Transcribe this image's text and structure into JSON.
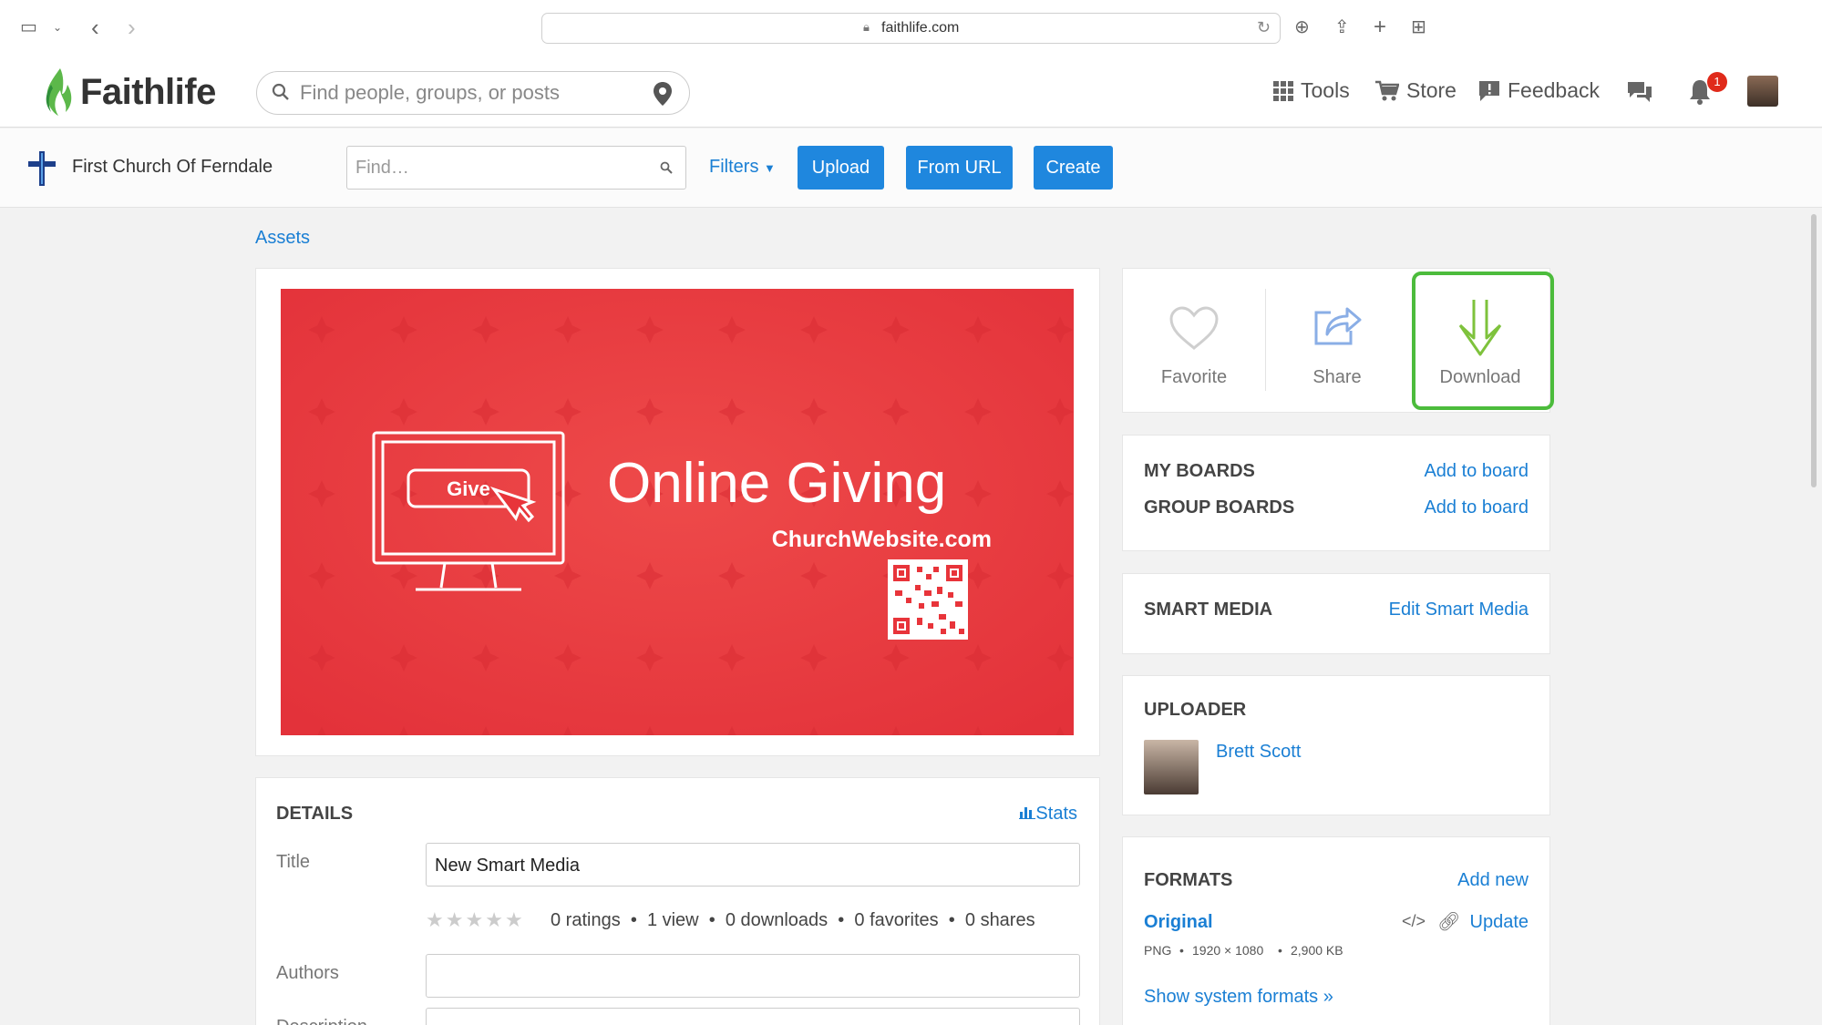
{
  "browser": {
    "url": "faithlife.com"
  },
  "header": {
    "logo_text": "Faithlife",
    "search_placeholder": "Find people, groups, or posts",
    "nav": {
      "tools": "Tools",
      "store": "Store",
      "feedback": "Feedback"
    },
    "notification_count": "1"
  },
  "group_bar": {
    "group_name": "First Church Of Ferndale",
    "find_placeholder": "Find…",
    "filters_label": "Filters",
    "upload_label": "Upload",
    "from_url_label": "From URL",
    "create_label": "Create"
  },
  "breadcrumb": "Assets",
  "preview": {
    "give_label": "Give",
    "headline": "Online Giving",
    "website": "ChurchWebsite.com",
    "colors": {
      "background": "#e8343a",
      "foreground": "#ffffff"
    }
  },
  "actions": {
    "favorite": "Favorite",
    "share": "Share",
    "download": "Download",
    "highlight_color": "#4cbc3c"
  },
  "boards": {
    "my_boards": "MY BOARDS",
    "group_boards": "GROUP BOARDS",
    "add_to_board": "Add to board"
  },
  "smart_media": {
    "heading": "SMART MEDIA",
    "edit_link": "Edit Smart Media"
  },
  "uploader": {
    "heading": "UPLOADER",
    "name": "Brett Scott"
  },
  "formats": {
    "heading": "FORMATS",
    "add_new": "Add new",
    "original_label": "Original",
    "update_label": "Update",
    "file_type": "PNG",
    "dimensions": "1920 × 1080",
    "size": "2,900 KB",
    "show_system": "Show system formats »"
  },
  "details": {
    "heading": "DETAILS",
    "stats_link": "Stats",
    "title_label": "Title",
    "title_value": "New Smart Media",
    "stats_line": "0 ratings  •  1 view  •  0 downloads  •  0 favorites  •  0 shares",
    "authors_label": "Authors",
    "description_label": "Description"
  }
}
